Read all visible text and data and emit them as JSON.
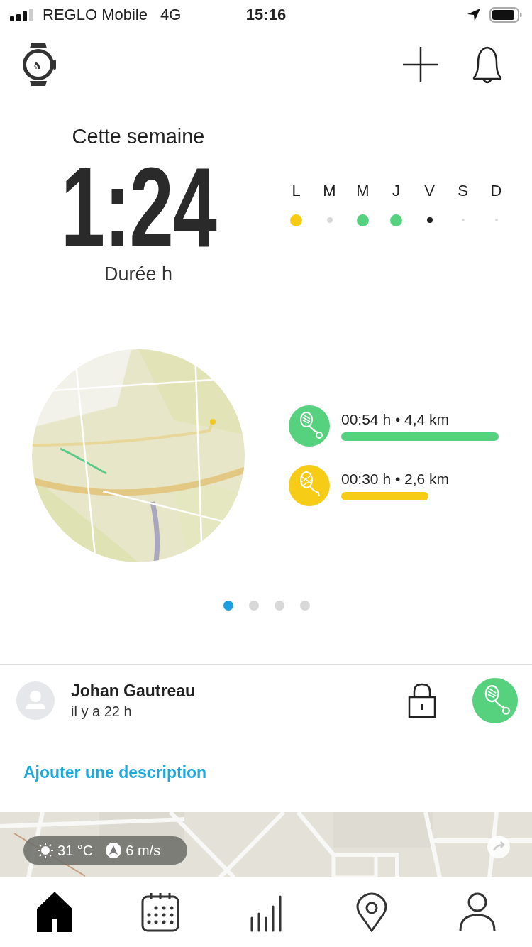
{
  "status_bar": {
    "carrier": "REGLO Mobile",
    "network": "4G",
    "time": "15:16"
  },
  "week": {
    "title": "Cette semaine",
    "value": "1:24",
    "unit": "Durée h",
    "days": [
      {
        "label": "L",
        "kind": "activity",
        "color": "#f7cc16"
      },
      {
        "label": "M",
        "kind": "rest",
        "color": "#d9d9d9"
      },
      {
        "label": "M",
        "kind": "activity",
        "color": "#56d27f"
      },
      {
        "label": "J",
        "kind": "activity",
        "color": "#56d27f"
      },
      {
        "label": "V",
        "kind": "today",
        "color": "#222222"
      },
      {
        "label": "S",
        "kind": "future",
        "color": "#dddddd"
      },
      {
        "label": "D",
        "kind": "future",
        "color": "#dddddd"
      }
    ]
  },
  "activities": [
    {
      "summary": "00:54 h • 4,4 km",
      "color": "#56d27f"
    },
    {
      "summary": "00:30 h • 2,6 km",
      "color": "#f7cc16"
    }
  ],
  "pager": [
    {
      "selected": true
    },
    {
      "selected": false
    },
    {
      "selected": false
    },
    {
      "selected": false
    }
  ],
  "post": {
    "author": "Johan Gautreau",
    "time": "il y a 22 h",
    "link": "Ajouter une description",
    "weather": {
      "temperature": "31 °C",
      "wind": "6 m/s"
    }
  },
  "nav": [
    {
      "kind": "home",
      "selected": true
    },
    {
      "kind": "calendar",
      "selected": false
    },
    {
      "kind": "stats",
      "selected": false
    },
    {
      "kind": "map",
      "selected": false
    },
    {
      "kind": "profile",
      "selected": false
    }
  ]
}
